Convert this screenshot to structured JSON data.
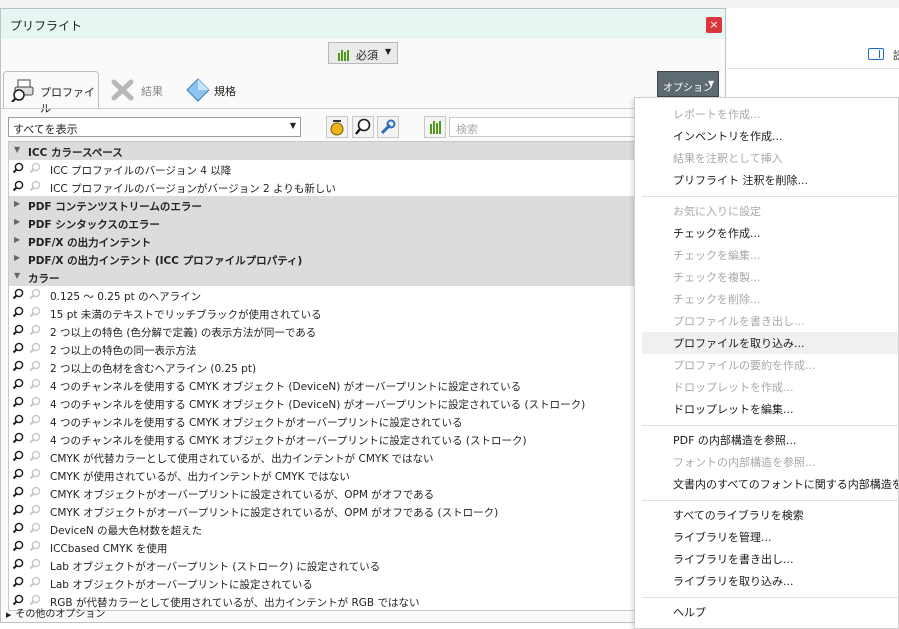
{
  "background": {
    "header_text": "読"
  },
  "dialog": {
    "title": "プリフライト",
    "close_glyph": "×",
    "required_label": "必須",
    "tabs": [
      {
        "label": "プロファイル"
      },
      {
        "label": "結果"
      },
      {
        "label": "規格"
      }
    ],
    "options_label": "オプション",
    "filter_value": "すべてを表示",
    "search_placeholder": "検索",
    "list": [
      {
        "type": "cat",
        "expanded": true,
        "label": "ICC カラースペース"
      },
      {
        "type": "item",
        "label": "ICC プロファイルのバージョン 4 以降"
      },
      {
        "type": "item",
        "label": "ICC プロファイルのバージョンがバージョン 2 よりも新しい"
      },
      {
        "type": "cat",
        "expanded": false,
        "label": "PDF コンテンツストリームのエラー"
      },
      {
        "type": "cat",
        "expanded": false,
        "label": "PDF シンタックスのエラー"
      },
      {
        "type": "cat",
        "expanded": false,
        "label": "PDF/X の出力インテント"
      },
      {
        "type": "cat",
        "expanded": false,
        "label": "PDF/X の出力インテント (ICC プロファイルプロパティ)"
      },
      {
        "type": "cat",
        "expanded": true,
        "label": "カラー"
      },
      {
        "type": "item",
        "label": "0.125 〜 0.25 pt のヘアライン"
      },
      {
        "type": "item",
        "label": "15 pt 未満のテキストでリッチブラックが使用されている"
      },
      {
        "type": "item",
        "label": "2 つ以上の特色 (色分解で定義) の表示方法が同一である"
      },
      {
        "type": "item",
        "label": "2 つ以上の特色の同一表示方法"
      },
      {
        "type": "item",
        "label": "2 つ以上の色材を含むヘアライン (0.25 pt)"
      },
      {
        "type": "item",
        "label": "4 つのチャンネルを使用する CMYK オブジェクト (DeviceN) がオーバープリントに設定されている"
      },
      {
        "type": "item",
        "label": "4 つのチャンネルを使用する CMYK オブジェクト (DeviceN) がオーバープリントに設定されている (ストローク)"
      },
      {
        "type": "item",
        "label": "4 つのチャンネルを使用する CMYK オブジェクトがオーバープリントに設定されている"
      },
      {
        "type": "item",
        "label": "4 つのチャンネルを使用する CMYK オブジェクトがオーバープリントに設定されている (ストローク)"
      },
      {
        "type": "item",
        "label": "CMYK が代替カラーとして使用されているが、出力インテントが CMYK ではない"
      },
      {
        "type": "item",
        "label": "CMYK が使用されているが、出力インテントが CMYK ではない"
      },
      {
        "type": "item",
        "label": "CMYK オブジェクトがオーバープリントに設定されているが、OPM がオフである"
      },
      {
        "type": "item",
        "label": "CMYK オブジェクトがオーバープリントに設定されているが、OPM がオフである (ストローク)"
      },
      {
        "type": "item",
        "label": "DeviceN の最大色材数を超えた"
      },
      {
        "type": "item",
        "label": "ICCbased CMYK を使用"
      },
      {
        "type": "item",
        "label": "Lab オブジェクトがオーバープリント (ストローク) に設定されている"
      },
      {
        "type": "item",
        "label": "Lab オブジェクトがオーバープリントに設定されている"
      },
      {
        "type": "item",
        "label": "RGB が代替カラーとして使用されているが、出力インテントが RGB ではない"
      }
    ],
    "footer_label": "その他のオプション"
  },
  "menu": {
    "groups": [
      [
        {
          "label": "レポートを作成...",
          "enabled": false
        },
        {
          "label": "インベントリを作成...",
          "enabled": true
        },
        {
          "label": "結果を注釈として挿入",
          "enabled": false
        },
        {
          "label": "プリフライト 注釈を削除...",
          "enabled": true
        }
      ],
      [
        {
          "label": "お気に入りに設定",
          "enabled": false
        },
        {
          "label": "チェックを作成...",
          "enabled": true
        },
        {
          "label": "チェックを編集...",
          "enabled": false
        },
        {
          "label": "チェックを複製...",
          "enabled": false
        },
        {
          "label": "チェックを削除...",
          "enabled": false
        },
        {
          "label": "プロファイルを書き出し...",
          "enabled": false
        },
        {
          "label": "プロファイルを取り込み...",
          "enabled": true,
          "highlighted": true
        },
        {
          "label": "プロファイルの要約を作成...",
          "enabled": false
        },
        {
          "label": "ドロップレットを作成...",
          "enabled": false
        },
        {
          "label": "ドロップレットを編集...",
          "enabled": true
        }
      ],
      [
        {
          "label": "PDF の内部構造を参照...",
          "enabled": true
        },
        {
          "label": "フォントの内部構造を参照...",
          "enabled": false
        },
        {
          "label": "文書内のすべてのフォントに関する内部構造を参",
          "enabled": true
        }
      ],
      [
        {
          "label": "すべてのライブラリを検索",
          "enabled": true
        },
        {
          "label": "ライブラリを管理...",
          "enabled": true
        },
        {
          "label": "ライブラリを書き出し...",
          "enabled": true
        },
        {
          "label": "ライブラリを取り込み...",
          "enabled": true
        }
      ],
      [
        {
          "label": "ヘルプ",
          "enabled": true
        }
      ]
    ]
  },
  "colors": {
    "accent": "#1b6ac9",
    "close": "#d9363e",
    "title_bg": "#e7f6f3",
    "options_btn": "#5e6b72"
  }
}
